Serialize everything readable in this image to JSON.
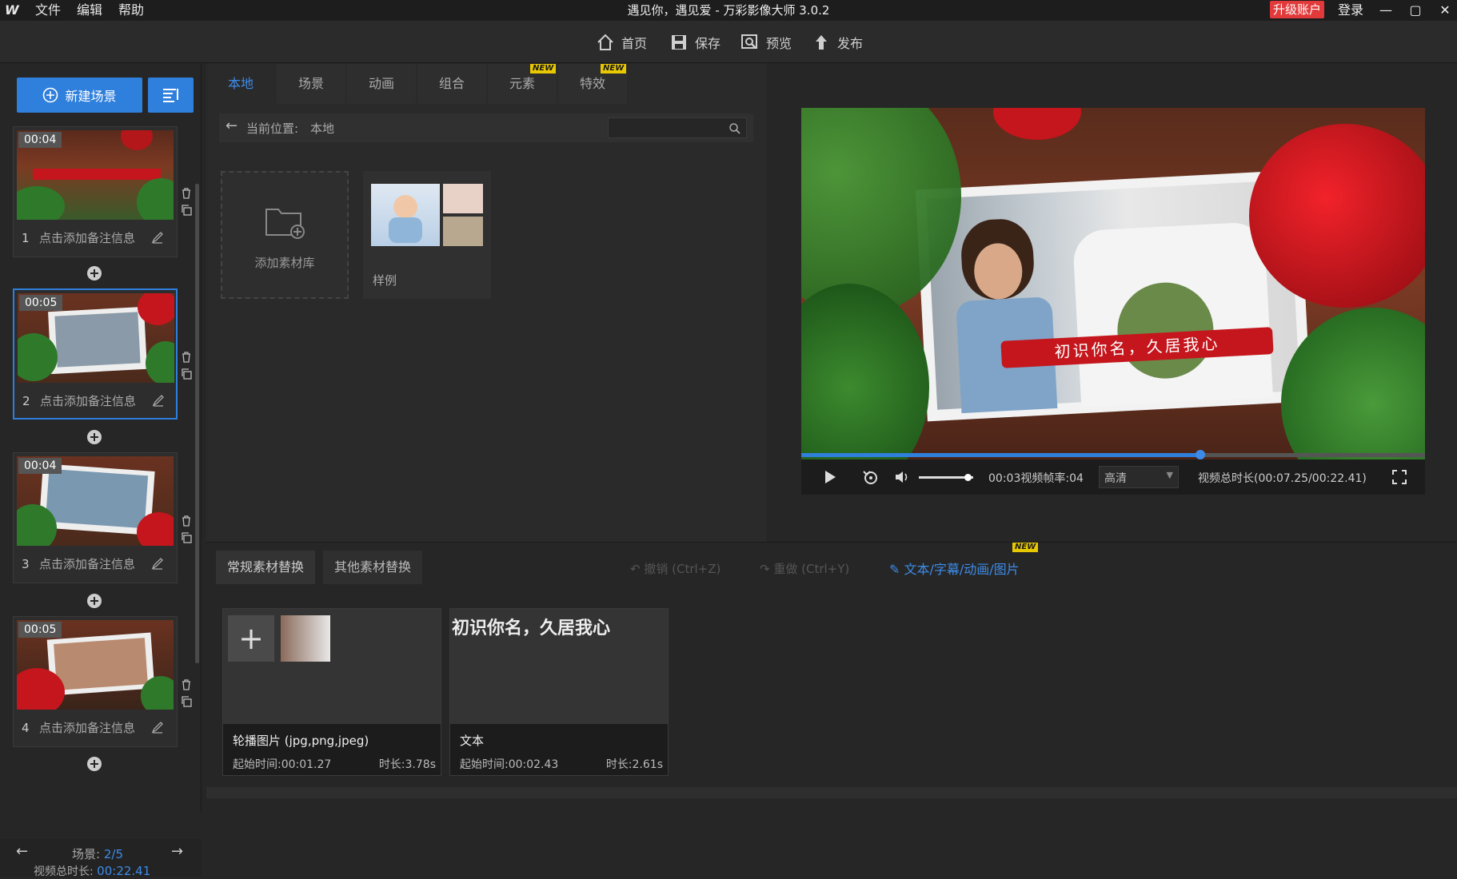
{
  "app": {
    "logo": "W",
    "title": "遇见你，遇见爱 - 万彩影像大师 3.0.2",
    "menu": [
      "文件",
      "编辑",
      "帮助"
    ],
    "upgrade": "升级账户",
    "login": "登录"
  },
  "toolbar": {
    "home": "首页",
    "save": "保存",
    "preview": "预览",
    "publish": "发布"
  },
  "left": {
    "new_scene": "新建场景",
    "scenes": [
      {
        "index": "1",
        "duration": "00:04",
        "note": "点击添加备注信息"
      },
      {
        "index": "2",
        "duration": "00:05",
        "note": "点击添加备注信息"
      },
      {
        "index": "3",
        "duration": "00:04",
        "note": "点击添加备注信息"
      },
      {
        "index": "4",
        "duration": "00:05",
        "note": "点击添加备注信息"
      }
    ],
    "scene_count_label": "场景:",
    "scene_count_value": "2/5",
    "total_label": "视频总时长:",
    "total_value": "00:22.41"
  },
  "library": {
    "tabs": [
      {
        "label": "本地",
        "new": ""
      },
      {
        "label": "场景",
        "new": ""
      },
      {
        "label": "动画",
        "new": ""
      },
      {
        "label": "组合",
        "new": ""
      },
      {
        "label": "元素",
        "new": "NEW"
      },
      {
        "label": "特效",
        "new": "NEW"
      }
    ],
    "path_label": "当前位置:",
    "path_value": "本地",
    "add_library": "添加素材库",
    "sample": "样例"
  },
  "preview": {
    "caption": "初识你名，久居我心",
    "time_current": "00:0",
    "time_overlay": "3视频帧率:04",
    "quality": "高清",
    "total_duration": "视频总时长(00:07.25/00:22.41)",
    "progress": 0.64,
    "volume": 0.9
  },
  "bottom": {
    "tab_common": "常规素材替换",
    "tab_other": "其他素材替换",
    "undo": "撤销 (Ctrl+Z)",
    "redo": "重做 (Ctrl+Y)",
    "text_link": "文本/字幕/动画/图片",
    "text_link_new": "NEW",
    "assets": [
      {
        "title": "轮播图片 (jpg,png,jpeg)",
        "start": "起始时间:00:01.27",
        "duration": "时长:3.78s"
      },
      {
        "title": "文本",
        "start": "起始时间:00:02.43",
        "duration": "时长:2.61s",
        "preview_text": "初识你名，久居我心"
      }
    ]
  },
  "colors": {
    "accent": "#2f7fdc",
    "upgrade": "#e23a3a",
    "link": "#3d8be8"
  }
}
